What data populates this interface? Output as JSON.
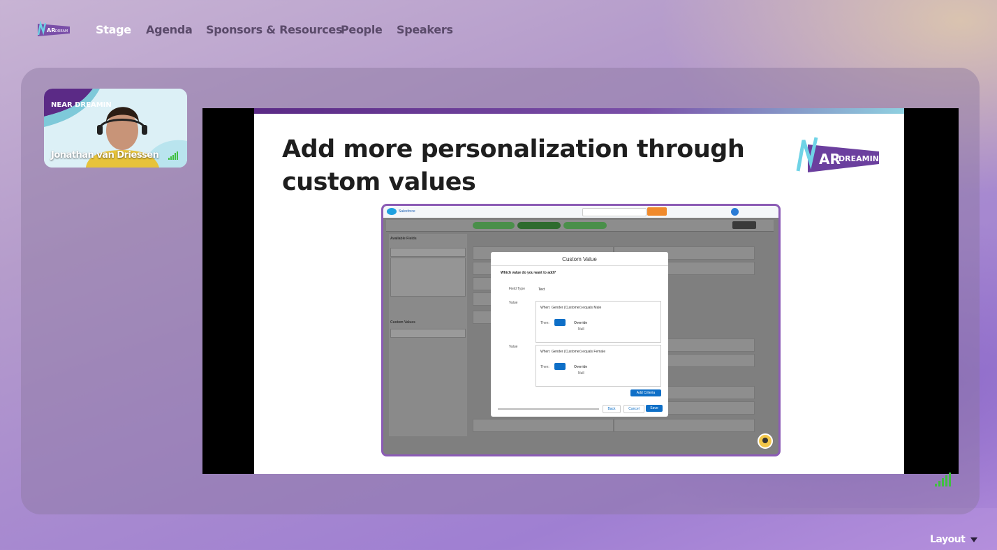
{
  "nav": {
    "brand_text": "NEAR DREAMIN",
    "items": [
      {
        "label": "Stage",
        "active": true
      },
      {
        "label": "Agenda",
        "active": false
      },
      {
        "label": "Sponsors & Resources",
        "active": false
      },
      {
        "label": "People",
        "active": false
      },
      {
        "label": "Speakers",
        "active": false
      }
    ]
  },
  "camera": {
    "participant_name": "Jonathan van Driessen",
    "signal_icon": "signal-bars-icon"
  },
  "slide": {
    "title_line1": "Add more personalization through",
    "title_line2": "custom values",
    "logo_text": "NEAR DREAMIN",
    "screenshot": {
      "app_name": "Salesforce",
      "modal_title": "Custom Value",
      "modal_question": "Which value do you want to add?",
      "field_type_label": "Field Type",
      "field_type_value": "Text",
      "value_label": "Value",
      "rule1_when": "When:  Gender (Customer) equals Male",
      "rule2_when": "When:  Gender (Customer) equals Female",
      "then_label": "Then:",
      "override_text": "Override",
      "null_text": "Null",
      "add_criteria_button": "Add Criteria",
      "back_button": "Back",
      "cancel_button": "Cancel",
      "save_button": "Save",
      "available_fields": "Available Fields",
      "custom_values": "Custom Values"
    }
  },
  "footer": {
    "layout_label": "Layout",
    "layout_icon": "caret-down-icon"
  },
  "colors": {
    "accent_purple": "#5b2a86",
    "signal_green": "#3fbf3f",
    "sf_blue": "#0e6fc7"
  }
}
